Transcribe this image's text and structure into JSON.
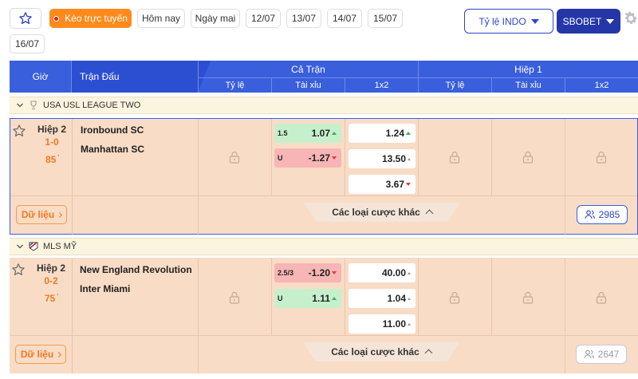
{
  "toolbar": {
    "live_label": "Kèo trực tuyến",
    "dates": [
      "Hôm nay",
      "Ngày mai",
      "12/07",
      "13/07",
      "14/07",
      "15/07",
      "16/07"
    ],
    "odds_type": "Tỷ lệ INDO",
    "bookmaker": "SBOBET"
  },
  "header": {
    "time": "Giờ",
    "match": "Trận Đấu",
    "full_match": "Cả Trận",
    "half1": "Hiệp 1",
    "cols": [
      "Tỷ lệ",
      "Tài xỉu",
      "1x2",
      "Tỷ lệ",
      "Tài xỉu",
      "1x2"
    ]
  },
  "leagues": [
    {
      "name": "USA USL LEAGUE TWO",
      "match": {
        "period": "Hiệp 2",
        "score": "1-0",
        "minute": "85",
        "home": "Ironbound SC",
        "away": "Manhattan SC",
        "ou_over_line": "1.5",
        "ou_over_odds": "1.07",
        "ou_under_line": "U",
        "ou_under_odds": "-1.27",
        "x12": [
          "1.24",
          "13.50",
          "3.67"
        ],
        "data_label": "Dữ liệu",
        "other_bets": "Các loại cược khác",
        "count": "2985"
      }
    },
    {
      "name": "MLS MỸ",
      "match": {
        "period": "Hiệp 2",
        "score": "0-2",
        "minute": "75",
        "home": "New England Revolution",
        "away": "Inter Miami",
        "ou_over_line": "2.5/3",
        "ou_over_odds": "-1.20",
        "ou_under_line": "U",
        "ou_under_odds": "1.11",
        "x12": [
          "40.00",
          "1.04",
          "11.00"
        ],
        "data_label": "Dữ liệu",
        "other_bets": "Các loại cược khác",
        "count": "2647"
      }
    }
  ],
  "colors": {
    "accent": "#3a5fdc",
    "live": "#ff8a1c",
    "row_bg": "#f8dcc6",
    "league_bg": "#fbf4de"
  }
}
